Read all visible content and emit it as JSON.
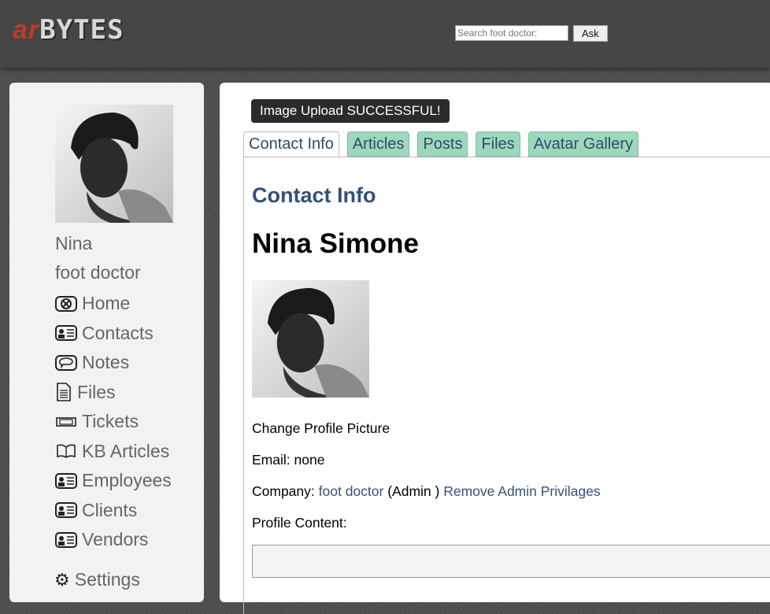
{
  "header": {
    "logo_ar": "ar",
    "logo_bytes": "BYTES",
    "search_placeholder": "Search foot doctor:",
    "ask_label": "Ask"
  },
  "sidebar": {
    "name": "Nina",
    "company": "foot doctor",
    "items": [
      {
        "label": "Home",
        "icon": "home-icon"
      },
      {
        "label": "Contacts",
        "icon": "contact-card-icon"
      },
      {
        "label": "Notes",
        "icon": "speech-bubble-icon"
      },
      {
        "label": "Files",
        "icon": "document-icon"
      },
      {
        "label": "Tickets",
        "icon": "ticket-icon"
      },
      {
        "label": "KB Articles",
        "icon": "book-icon"
      },
      {
        "label": "Employees",
        "icon": "contact-card-icon"
      },
      {
        "label": "Clients",
        "icon": "contact-card-icon"
      },
      {
        "label": "Vendors",
        "icon": "contact-card-icon"
      }
    ],
    "settings_label": "Settings"
  },
  "main": {
    "flash": "Image Upload SUCCESSFUL!",
    "tabs": [
      "Contact Info",
      "Articles",
      "Posts",
      "Files",
      "Avatar Gallery"
    ],
    "section_title": "Contact Info",
    "person_name": "Nina Simone",
    "change_picture": "Change Profile Picture",
    "email_label": "Email:",
    "email_value": "none",
    "company_label": "Company:",
    "company_value": "foot doctor",
    "company_role": "(Admin )",
    "remove_admin": "Remove Admin Privilages",
    "profile_label": "Profile Content:"
  },
  "colors": {
    "logo_accent": "#c0392b",
    "link": "#34507a",
    "tab_bg": "#9fd7bd",
    "flash_bg": "#2b2b2b"
  }
}
